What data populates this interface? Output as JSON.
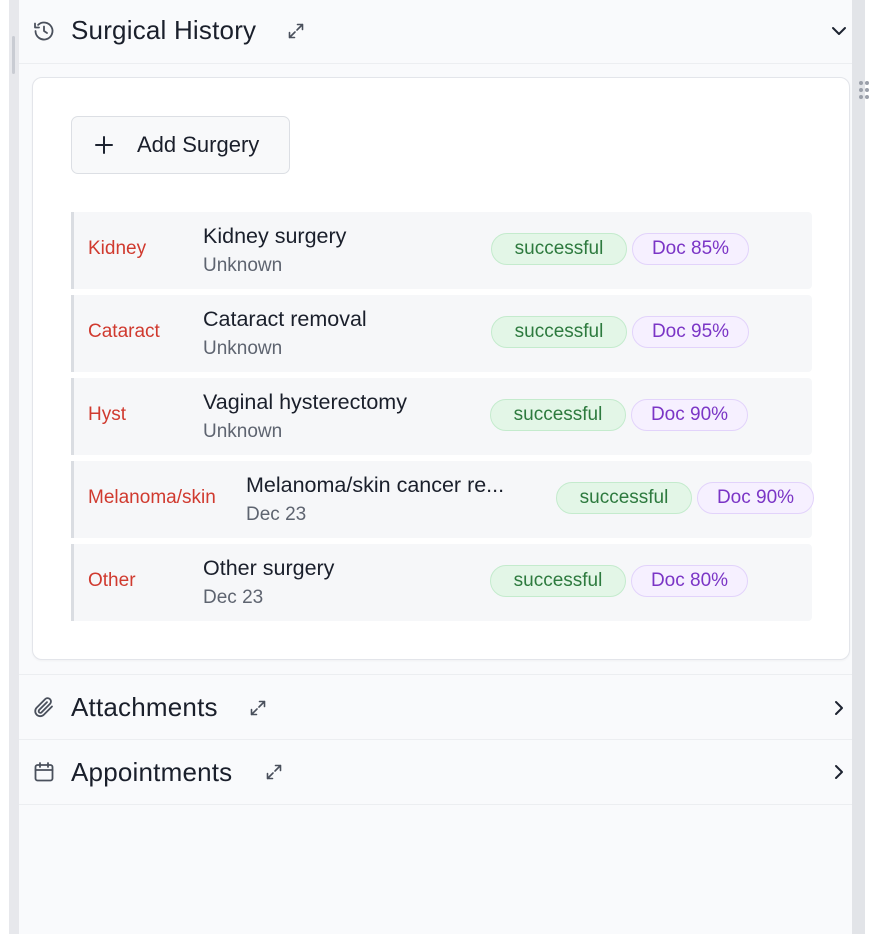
{
  "surgical_history": {
    "title": "Surgical History",
    "add_button_label": "Add Surgery",
    "surgeries": [
      {
        "category": "Kidney",
        "name": "Kidney surgery",
        "date": "Unknown",
        "outcome": "successful",
        "doc_confidence": "Doc 85%"
      },
      {
        "category": "Cataract",
        "name": "Cataract removal",
        "date": "Unknown",
        "outcome": "successful",
        "doc_confidence": "Doc 95%"
      },
      {
        "category": "Hyst",
        "name": "Vaginal hysterectomy",
        "date": "Unknown",
        "outcome": "successful",
        "doc_confidence": "Doc 90%"
      },
      {
        "category": "Melanoma/skin",
        "name": "Melanoma/skin cancer re...",
        "date": "Dec 23",
        "outcome": "successful",
        "doc_confidence": "Doc 90%"
      },
      {
        "category": "Other",
        "name": "Other surgery",
        "date": "Dec 23",
        "outcome": "successful",
        "doc_confidence": "Doc 80%"
      }
    ]
  },
  "attachments": {
    "title": "Attachments"
  },
  "appointments": {
    "title": "Appointments"
  },
  "icons": {
    "surgical_history": "history-clock-icon",
    "attachments": "paperclip-icon",
    "appointments": "calendar-icon",
    "expand": "expand-arrows-icon",
    "collapse": "chevron-down-icon",
    "open": "chevron-right-icon",
    "add": "plus-icon"
  },
  "colors": {
    "category_text": "#d03a2f",
    "successful_bg": "#e3f6e7",
    "successful_text": "#2d7a3e",
    "doc_bg": "#f6f0ff",
    "doc_text": "#7b35c6"
  }
}
